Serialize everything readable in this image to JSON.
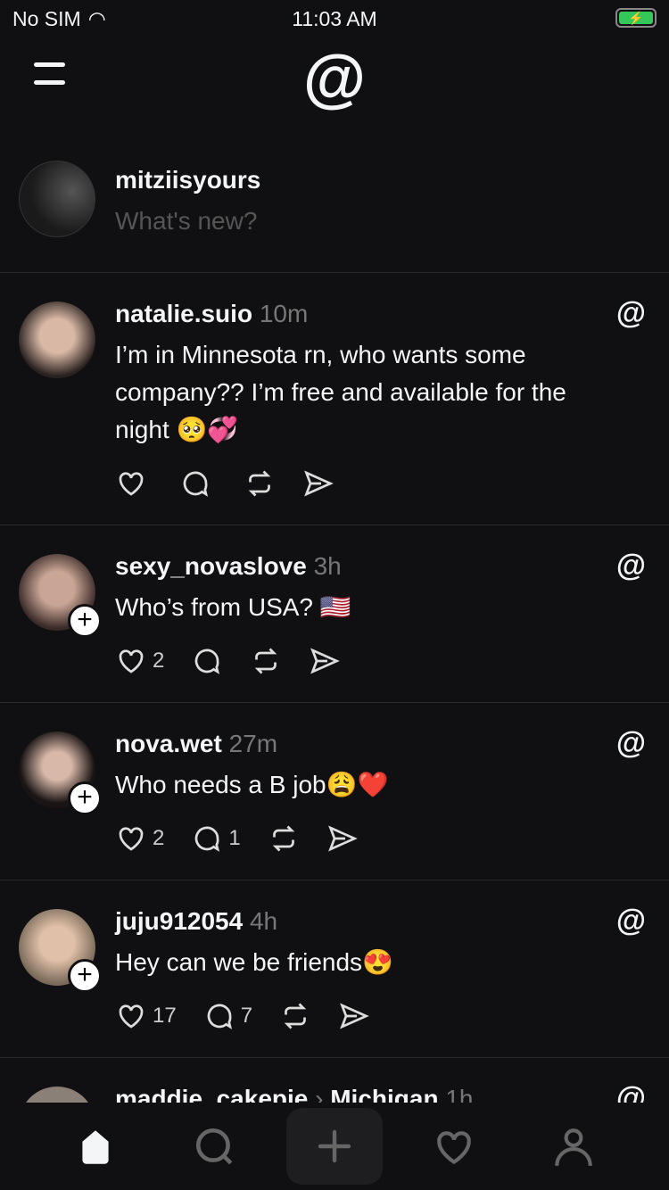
{
  "status": {
    "carrier": "No SIM",
    "time": "11:03 AM"
  },
  "composer": {
    "username": "mitziisyours",
    "placeholder": "What's new?"
  },
  "posts": [
    {
      "username": "natalie.suio",
      "time": "10m",
      "text": "I’m in Minnesota rn, who wants some company?? I’m free and available for the night 🥺💞",
      "likes": "",
      "replies": "",
      "follow": false
    },
    {
      "username": "sexy_novaslove",
      "time": "3h",
      "text": "Who’s from USA? 🇺🇸",
      "likes": "2",
      "replies": "",
      "follow": true
    },
    {
      "username": "nova.wet",
      "time": "27m",
      "text": "Who needs a B job😩❤️",
      "likes": "2",
      "replies": "1",
      "follow": true
    },
    {
      "username": "juju912054",
      "time": "4h",
      "text": "Hey can we be friends😍",
      "likes": "17",
      "replies": "7",
      "follow": true
    },
    {
      "username": "maddie_cakepie",
      "location": "Michigan",
      "time": "1h"
    }
  ],
  "colors": {
    "background": "#101012",
    "text": "#f3f5f7",
    "muted": "#777777",
    "battery": "#34c759"
  }
}
